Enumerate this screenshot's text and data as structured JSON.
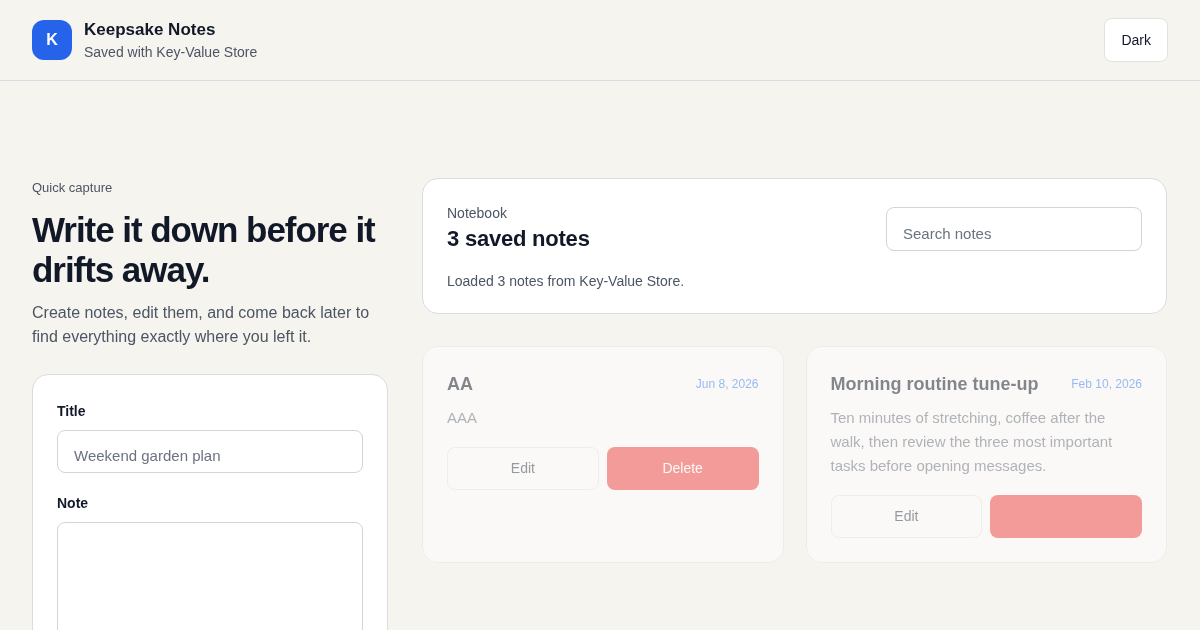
{
  "header": {
    "logo_letter": "K",
    "title": "Keepsake Notes",
    "subtitle": "Saved with Key-Value Store",
    "theme_button": "Dark"
  },
  "intro": {
    "eyebrow": "Quick capture",
    "heading": "Write it down before it drifts away.",
    "description": "Create notes, edit them, and come back later to find everything exactly where you left it."
  },
  "form": {
    "fields": [
      {
        "kind": "input",
        "label": "Title",
        "placeholder": "Weekend garden plan"
      },
      {
        "kind": "textarea",
        "label": "Note"
      }
    ]
  },
  "notebook": {
    "eyebrow": "Notebook",
    "title": "3 saved notes",
    "status": "Loaded 3 notes from Key-Value Store.",
    "search": {
      "placeholder": "Search notes"
    }
  },
  "notes": [
    {
      "title": "AA",
      "date": "Jun 8, 2026",
      "body": "AAA",
      "dimmed": true,
      "edit_button": "Edit",
      "delete_button": "Delete"
    },
    {
      "title": "Morning routine tune-up",
      "date": "Feb 10, 2026",
      "body": "Ten minutes of stretching, coffee after the walk, then review the three most important tasks before opening messages.",
      "dimmed": true,
      "edit_button": "Edit"
    }
  ]
}
